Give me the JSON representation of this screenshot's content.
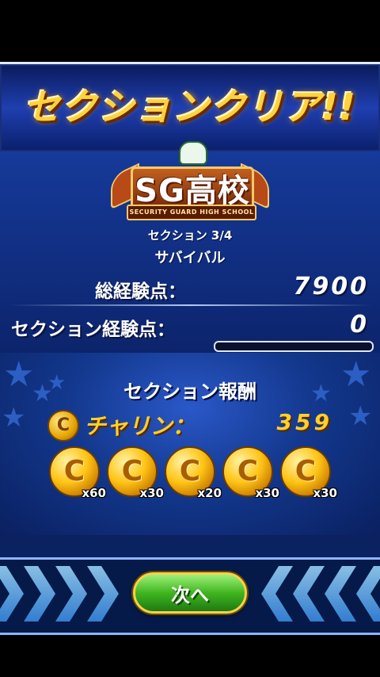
{
  "banner": {
    "title": "セクションクリア!!"
  },
  "school": {
    "name": "SG高校",
    "subtitle": "SECURITY GUARD HIGH SCHOOL"
  },
  "section": {
    "label": "セクション 3/4",
    "name": "サバイバル"
  },
  "stats": {
    "total_exp_label": "総経験点：",
    "total_exp_value": "7900",
    "section_exp_label": "セクション経験点：",
    "section_exp_value": "0",
    "section_exp_progress": 0
  },
  "reward": {
    "title": "セクション報酬",
    "currency_label": "チャリン：",
    "currency_value": "359",
    "coins": [
      {
        "qty": "x60"
      },
      {
        "qty": "x30"
      },
      {
        "qty": "x20"
      },
      {
        "qty": "x30"
      },
      {
        "qty": "x30"
      }
    ]
  },
  "footer": {
    "next_label": "次へ"
  },
  "colors": {
    "accent_gold": "#ffd02a",
    "button_green": "#3fb51f",
    "panel_blue": "#0d2670"
  },
  "icons": {
    "coin": "coin-icon",
    "star": "star-icon",
    "chevron": "chevron-icon"
  }
}
